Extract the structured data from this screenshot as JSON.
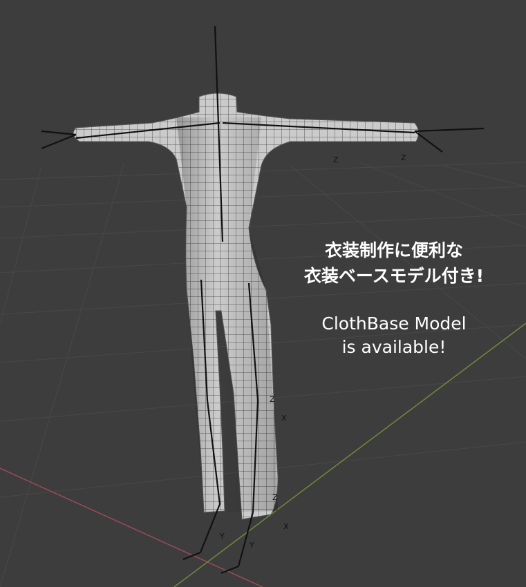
{
  "caption": {
    "japanese_line1": "衣装制作に便利な",
    "japanese_line2": "衣装ベースモデル付き!",
    "english_line1": "ClothBase Model",
    "english_line2": "is available!"
  },
  "axis_labels": {
    "x": "X",
    "y": "Y",
    "z": "Z"
  },
  "colors": {
    "background": "#3d3d3d",
    "grid": "#4a4a4a",
    "x_axis": "#9c4b56",
    "y_axis": "#6e8c3a",
    "mesh_fill": "#c9c9c9",
    "bone": "#111111"
  }
}
